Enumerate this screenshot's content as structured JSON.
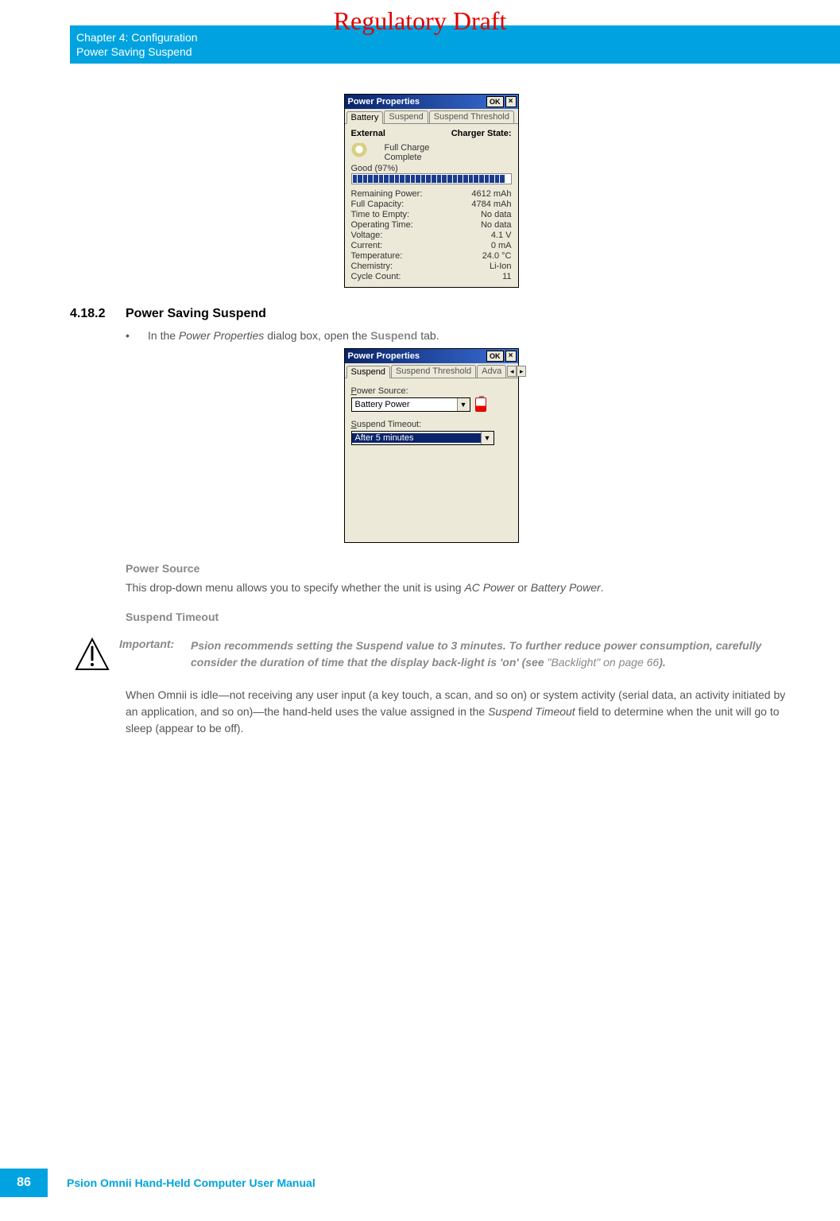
{
  "watermark": "Regulatory Draft",
  "header": {
    "chapter": "Chapter 4:  Configuration",
    "section": "Power Saving Suspend"
  },
  "dialog1": {
    "title": "Power Properties",
    "ok": "OK",
    "close": "×",
    "tabs": [
      "Battery",
      "Suspend",
      "Suspend Threshold"
    ],
    "active_tab": 0,
    "col_left": "External",
    "col_right": "Charger State:",
    "charger_lines": [
      "Full Charge",
      "Complete"
    ],
    "good_label": "Good  (97%)",
    "progress_pct": 97,
    "stats": [
      {
        "k": "Remaining Power:",
        "v": "4612 mAh"
      },
      {
        "k": "Full Capacity:",
        "v": "4784 mAh"
      },
      {
        "k": "Time to Empty:",
        "v": "No data"
      },
      {
        "k": "Operating Time:",
        "v": "No data"
      },
      {
        "k": "Voltage:",
        "v": "4.1 V"
      },
      {
        "k": "Current:",
        "v": "0 mA"
      },
      {
        "k": "Temperature:",
        "v": "24.0 °C"
      },
      {
        "k": "Chemistry:",
        "v": "Li-Ion"
      },
      {
        "k": "Cycle Count:",
        "v": "11"
      }
    ]
  },
  "section": {
    "num": "4.18.2",
    "title": "Power Saving Suspend"
  },
  "bullet1": {
    "pre": "In the ",
    "em": "Power Properties",
    "mid": " dialog box, open the ",
    "strong": "Suspend",
    "post": " tab."
  },
  "dialog2": {
    "title": "Power Properties",
    "ok": "OK",
    "close": "×",
    "tabs": [
      "Suspend",
      "Suspend Threshold",
      "Adva"
    ],
    "active_tab": 0,
    "nav_left": "◂",
    "nav_right": "▸",
    "power_source_label_u": "P",
    "power_source_label_rest": "ower Source:",
    "power_source_value": "Battery Power",
    "suspend_timeout_label_u": "S",
    "suspend_timeout_label_rest": "uspend Timeout:",
    "suspend_timeout_value": "After 5 minutes"
  },
  "power_source": {
    "heading": "Power Source",
    "pre": "This drop-down menu allows you to specify whether the unit is using ",
    "em1": "AC Power",
    "mid": " or ",
    "em2": "Battery Power",
    "post": "."
  },
  "suspend_timeout_h": "Suspend Timeout",
  "important": {
    "label": "Important:",
    "text_pre": "Psion recommends setting the Suspend value to 3 minutes. To further reduce power consumption, carefully consider the duration of time that the display back-light is 'on' (see ",
    "link": "\"Backlight\" on page 66",
    "text_post": ")."
  },
  "para2": {
    "pre": "When Omnii is idle—not receiving any user input (a key touch, a scan, and so on) or system activity (serial data, an activity initiated by an application, and so on)—the hand-held uses the value assigned in the ",
    "em": "Suspend Timeout",
    "post": " field to determine when the unit will go to sleep (appear to be off)."
  },
  "footer": {
    "page": "86",
    "title": "Psion Omnii Hand-Held Computer User Manual"
  }
}
